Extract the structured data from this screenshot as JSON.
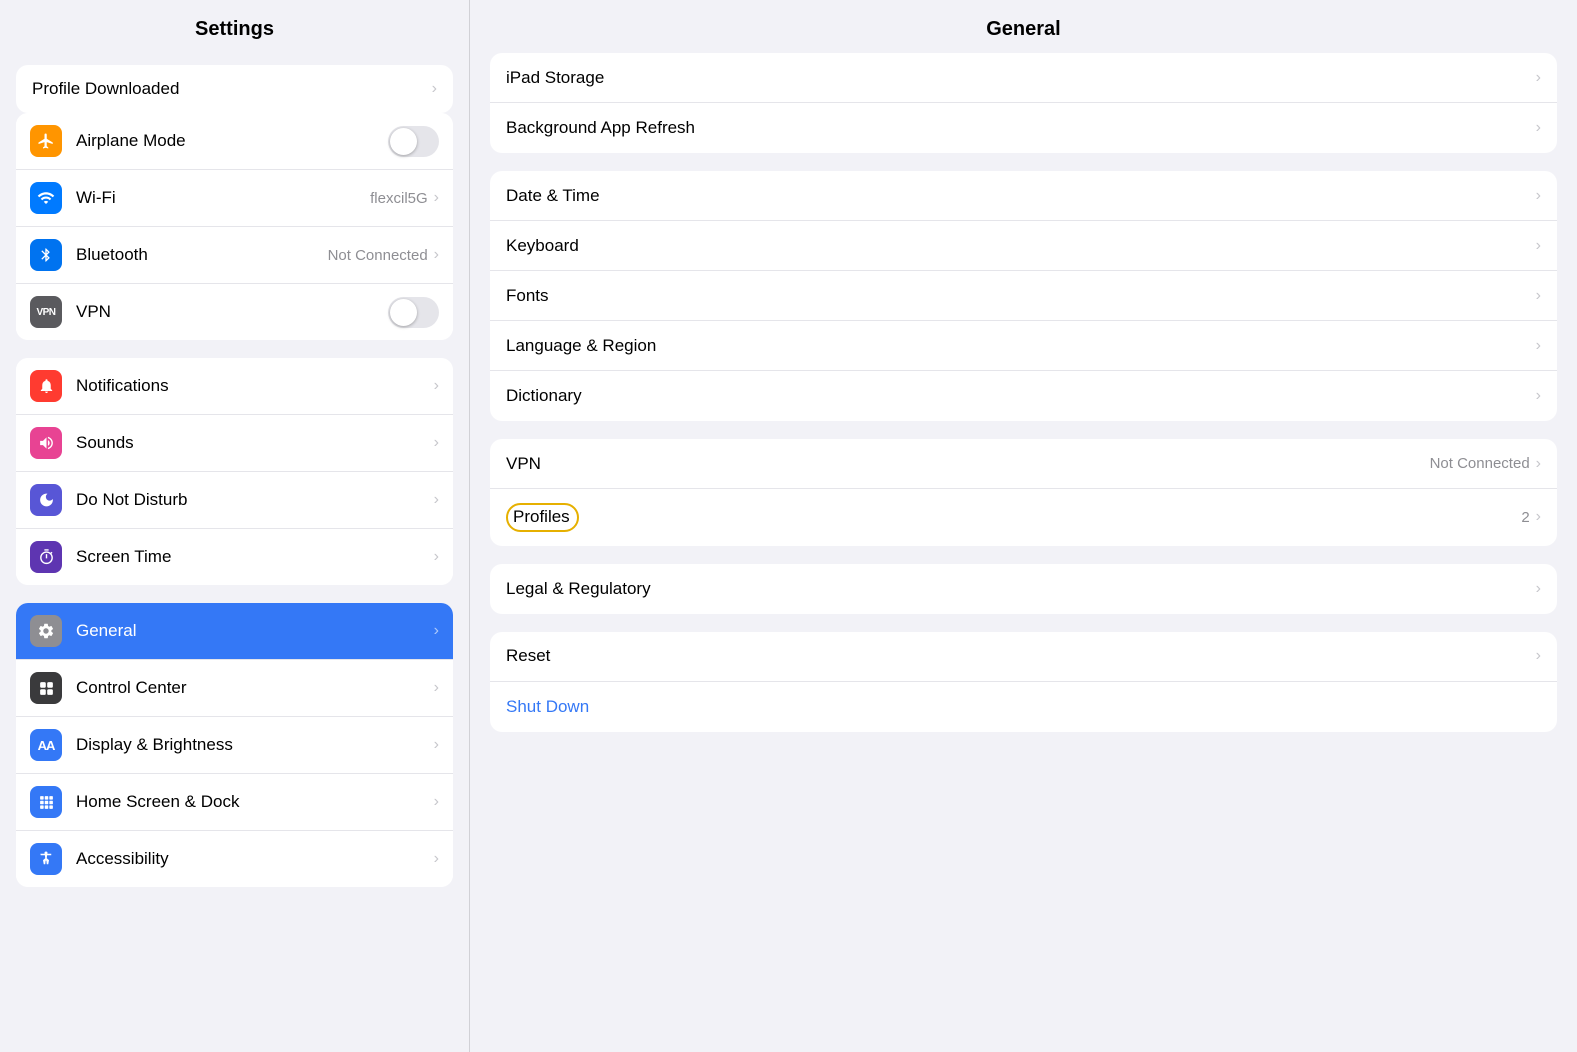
{
  "sidebar": {
    "header": "Settings",
    "profile_downloaded": "Profile Downloaded",
    "sections": [
      {
        "id": "connectivity",
        "items": [
          {
            "id": "airplane-mode",
            "label": "Airplane Mode",
            "icon": "✈",
            "icon_bg": "icon-orange",
            "control": "toggle",
            "value": ""
          },
          {
            "id": "wifi",
            "label": "Wi-Fi",
            "icon": "wifi",
            "icon_bg": "icon-blue",
            "control": "chevron",
            "value": "flexcil5G"
          },
          {
            "id": "bluetooth",
            "label": "Bluetooth",
            "icon": "bluetooth",
            "icon_bg": "icon-blue2",
            "control": "chevron",
            "value": "Not Connected"
          },
          {
            "id": "vpn",
            "label": "VPN",
            "icon": "VPN",
            "icon_bg": "icon-gray",
            "control": "toggle",
            "value": ""
          }
        ]
      },
      {
        "id": "notifications-sounds",
        "items": [
          {
            "id": "notifications",
            "label": "Notifications",
            "icon": "bell",
            "icon_bg": "icon-red2",
            "control": "chevron",
            "value": ""
          },
          {
            "id": "sounds",
            "label": "Sounds",
            "icon": "sound",
            "icon_bg": "icon-pink",
            "control": "chevron",
            "value": ""
          },
          {
            "id": "do-not-disturb",
            "label": "Do Not Disturb",
            "icon": "moon",
            "icon_bg": "icon-indigo",
            "control": "chevron",
            "value": ""
          },
          {
            "id": "screen-time",
            "label": "Screen Time",
            "icon": "hourglass",
            "icon_bg": "icon-purple",
            "control": "chevron",
            "value": ""
          }
        ]
      },
      {
        "id": "system",
        "items": [
          {
            "id": "general",
            "label": "General",
            "icon": "gear",
            "icon_bg": "icon-gray",
            "control": "chevron",
            "value": "",
            "active": true
          },
          {
            "id": "control-center",
            "label": "Control Center",
            "icon": "cc",
            "icon_bg": "icon-dark",
            "control": "chevron",
            "value": ""
          },
          {
            "id": "display-brightness",
            "label": "Display & Brightness",
            "icon": "AA",
            "icon_bg": "icon-blue3",
            "control": "chevron",
            "value": ""
          },
          {
            "id": "home-screen",
            "label": "Home Screen & Dock",
            "icon": "grid",
            "icon_bg": "icon-blue3",
            "control": "chevron",
            "value": ""
          },
          {
            "id": "accessibility",
            "label": "Accessibility",
            "icon": "person",
            "icon_bg": "icon-blue3",
            "control": "chevron",
            "value": ""
          }
        ]
      }
    ]
  },
  "main": {
    "header": "General",
    "sections": [
      {
        "id": "storage-refresh",
        "items": [
          {
            "id": "ipad-storage",
            "label": "iPad Storage",
            "value": "",
            "control": "chevron"
          },
          {
            "id": "background-refresh",
            "label": "Background App Refresh",
            "value": "",
            "control": "chevron"
          }
        ]
      },
      {
        "id": "regional",
        "items": [
          {
            "id": "date-time",
            "label": "Date & Time",
            "value": "",
            "control": "chevron"
          },
          {
            "id": "keyboard",
            "label": "Keyboard",
            "value": "",
            "control": "chevron"
          },
          {
            "id": "fonts",
            "label": "Fonts",
            "value": "",
            "control": "chevron"
          },
          {
            "id": "language-region",
            "label": "Language & Region",
            "value": "",
            "control": "chevron"
          },
          {
            "id": "dictionary",
            "label": "Dictionary",
            "value": "",
            "control": "chevron"
          }
        ]
      },
      {
        "id": "vpn-profiles",
        "items": [
          {
            "id": "vpn-main",
            "label": "VPN",
            "value": "Not Connected",
            "control": "chevron"
          },
          {
            "id": "profiles",
            "label": "Profiles",
            "value": "2",
            "control": "chevron",
            "annotated": true
          }
        ]
      },
      {
        "id": "legal",
        "items": [
          {
            "id": "legal-regulatory",
            "label": "Legal & Regulatory",
            "value": "",
            "control": "chevron"
          }
        ]
      },
      {
        "id": "reset-shutdown",
        "items": [
          {
            "id": "reset",
            "label": "Reset",
            "value": "",
            "control": "chevron"
          },
          {
            "id": "shut-down",
            "label": "Shut Down",
            "value": "",
            "control": "",
            "blue": true
          }
        ]
      }
    ]
  }
}
